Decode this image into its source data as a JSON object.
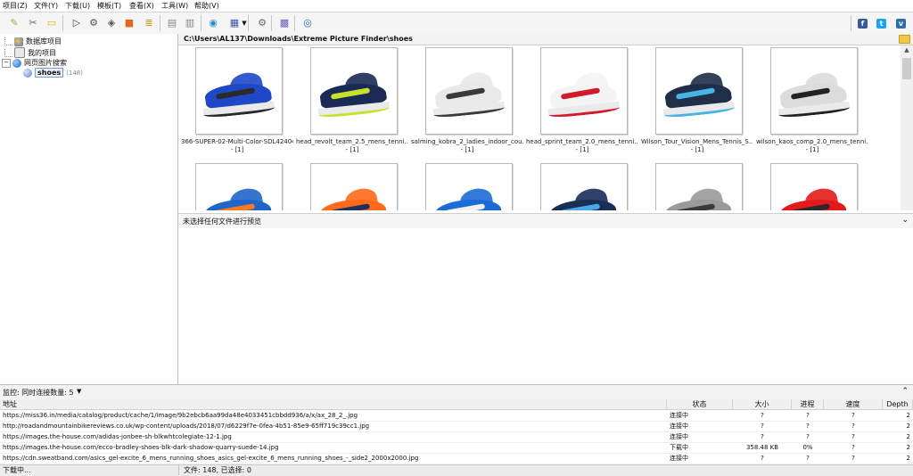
{
  "menu": [
    "项目(Z)",
    "文件(Y)",
    "下载(U)",
    "模板(T)",
    "查看(X)",
    "工具(W)",
    "帮助(V)"
  ],
  "toolbar_icons": [
    "edit-icon",
    "tools-icon",
    "comment-icon",
    "play-icon",
    "gear-icon",
    "step-icon",
    "db-icon",
    "stack-icon",
    "server-icon",
    "server-alt-icon",
    "web-icon",
    "grid-view-icon",
    "settings-icon",
    "filter-icon",
    "info-icon"
  ],
  "social_icons": [
    "facebook-icon",
    "twitter-icon",
    "vk-icon"
  ],
  "tree": {
    "items": [
      {
        "label": "数据库项目",
        "icon": "database-icon"
      },
      {
        "label": "我的项目",
        "icon": "project-icon"
      },
      {
        "label": "网页图片搜索",
        "icon": "web-search-icon"
      }
    ],
    "child": {
      "label": "shoes",
      "count": "(148)"
    }
  },
  "path": "C:\\Users\\AL137\\Downloads\\Extreme Picture Finder\\shoes",
  "thumbnails": [
    {
      "caption": "366-SUPER-02-Multi-Color-SDL42404...",
      "sub": "- [1]",
      "color": "#1e48c8",
      "accent": "#2a2a2a"
    },
    {
      "caption": "head_revolt_team_2.5_mens_tenni...",
      "sub": "- [1]",
      "color": "#1b2a55",
      "accent": "#c7e22a"
    },
    {
      "caption": "salming_kobra_2_ladies_indoor_cou...",
      "sub": "- [1]",
      "color": "#e9e9e9",
      "accent": "#3a3a3a"
    },
    {
      "caption": "head_sprint_team_2.0_mens_tenni...",
      "sub": "- [1]",
      "color": "#f4f4f4",
      "accent": "#d11a2a"
    },
    {
      "caption": "Wilson_Tour_Vision_Mens_Tennis_S...",
      "sub": "- [1]",
      "color": "#1f2f48",
      "accent": "#47b3e6"
    },
    {
      "caption": "wilson_kaos_comp_2.0_mens_tenni...",
      "sub": "- [1]",
      "color": "#dcdcdc",
      "accent": "#222222"
    },
    {
      "caption": "",
      "sub": "",
      "color": "#1f66c8",
      "accent": "#ff7a1a"
    },
    {
      "caption": "",
      "sub": "",
      "color": "#ff6a1a",
      "accent": "#1f3060"
    },
    {
      "caption": "",
      "sub": "",
      "color": "#1b6bd6",
      "accent": "#f0f0f0"
    },
    {
      "caption": "",
      "sub": "",
      "color": "#1a2e58",
      "accent": "#49a7e6"
    },
    {
      "caption": "",
      "sub": "",
      "color": "#9a9a9a",
      "accent": "#3a3a3a"
    },
    {
      "caption": "",
      "sub": "",
      "color": "#e31b1b",
      "accent": "#2a2a2a"
    }
  ],
  "preview_label": "未选择任何文件进行预览",
  "monitor": {
    "label": "监控: 同时连接数量: 5"
  },
  "table": {
    "headers": [
      "地址",
      "状态",
      "大小",
      "进程",
      "速度",
      "Depth"
    ],
    "rows": [
      {
        "url": "https://miss36.in/media/catalog/product/cache/1/image/9b2ebcb6aa99da48e4033451cbbdd936/a/x/ax_28_2_.jpg",
        "status": "连接中",
        "size": "?",
        "progress": "?",
        "speed": "?",
        "depth": "2"
      },
      {
        "url": "http://roadandmountainbikereviews.co.uk/wp-content/uploads/2018/07/d6229f7e-0fea-4b51-85e9-65ff719c39cc1.jpg",
        "status": "连接中",
        "size": "?",
        "progress": "?",
        "speed": "?",
        "depth": "2"
      },
      {
        "url": "https://images.the-house.com/adidas-jonbee-sh-blkwhtcolegiate-12-1.jpg",
        "status": "连接中",
        "size": "?",
        "progress": "?",
        "speed": "?",
        "depth": "2"
      },
      {
        "url": "https://images.the-house.com/ecco-bradley-shoes-blk-dark-shadow-quarry-suede-14.jpg",
        "status": "下载中",
        "size": "358.48 KB",
        "progress": "0%",
        "speed": "?",
        "depth": "2"
      },
      {
        "url": "https://cdn.sweatband.com/asics_gel-excite_6_mens_running_shoes_asics_gel-excite_6_mens_running_shoes_-_side2_2000x2000.jpg",
        "status": "连接中",
        "size": "?",
        "progress": "?",
        "speed": "?",
        "depth": "2"
      }
    ]
  },
  "status": {
    "left": "下载中...",
    "right": "文件: 148, 已选择: 0"
  }
}
